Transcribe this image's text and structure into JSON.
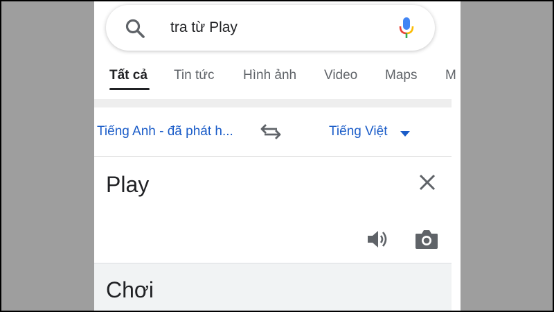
{
  "search": {
    "query": "tra từ Play"
  },
  "tabs": [
    {
      "label": "Tất cả",
      "active": true
    },
    {
      "label": "Tin tức",
      "active": false
    },
    {
      "label": "Hình ảnh",
      "active": false
    },
    {
      "label": "Video",
      "active": false
    },
    {
      "label": "Maps",
      "active": false
    },
    {
      "label": "M",
      "active": false
    }
  ],
  "translator": {
    "source_language": "Tiếng Anh - đã phát h...",
    "target_language": "Tiếng Việt",
    "input_text": "Play",
    "output_text": "Chơi"
  },
  "icons": {
    "search": "search-icon",
    "mic": "mic-icon",
    "swap": "swap-icon",
    "dropdown": "caret-down-icon",
    "clear": "close-icon",
    "listen": "speaker-icon",
    "camera": "camera-icon"
  },
  "colors": {
    "link_blue": "#1a5cc8",
    "text_dark": "#202124",
    "text_grey": "#5f6368",
    "output_bg": "#f1f3f4",
    "side_bg": "#9e9e9e"
  }
}
